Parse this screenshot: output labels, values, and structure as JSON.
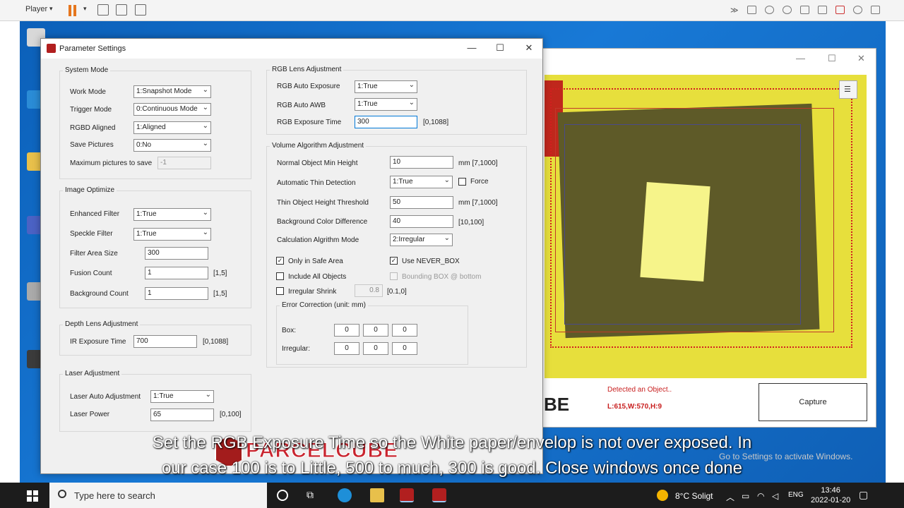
{
  "player": {
    "label": "Player"
  },
  "camera": {
    "detected": "Detected an Object..",
    "dims": "L:615,W:570,H:9",
    "capture": "Capture",
    "logo_fragment": "BE"
  },
  "dialog": {
    "title": "Parameter Settings",
    "system_mode": {
      "title": "System Mode",
      "work_mode": {
        "label": "Work Mode",
        "value": "1:Snapshot Mode"
      },
      "trigger_mode": {
        "label": "Trigger Mode",
        "value": "0:Continuous Mode"
      },
      "rgbd_aligned": {
        "label": "RGBD Aligned",
        "value": "1:Aligned"
      },
      "save_pictures": {
        "label": "Save Pictures",
        "value": "0:No"
      },
      "max_pictures": {
        "label": "Maximum pictures to save",
        "value": "-1"
      }
    },
    "image_optimize": {
      "title": "Image Optimize",
      "enhanced_filter": {
        "label": "Enhanced Filter",
        "value": "1:True"
      },
      "speckle_filter": {
        "label": "Speckle Filter",
        "value": "1:True"
      },
      "filter_area_size": {
        "label": "Filter Area Size",
        "value": "300"
      },
      "fusion_count": {
        "label": "Fusion Count",
        "value": "1",
        "range": "[1,5]"
      },
      "background_count": {
        "label": "Background Count",
        "value": "1",
        "range": "[1,5]"
      }
    },
    "depth_lens": {
      "title": "Depth Lens Adjustment",
      "ir_exposure": {
        "label": "IR Exposure Time",
        "value": "700",
        "range": "[0,1088]"
      }
    },
    "laser": {
      "title": "Laser Adjustment",
      "auto": {
        "label": "Laser Auto Adjustment",
        "value": "1:True"
      },
      "power": {
        "label": "Laser Power",
        "value": "65",
        "range": "[0,100]"
      }
    },
    "rgb_lens": {
      "title": "RGB Lens Adjustment",
      "auto_exposure": {
        "label": "RGB Auto Exposure",
        "value": "1:True"
      },
      "auto_awb": {
        "label": "RGB Auto AWB",
        "value": "1:True"
      },
      "exposure_time": {
        "label": "RGB Exposure Time",
        "value": "300",
        "range": "[0,1088]"
      }
    },
    "volume": {
      "title": "Volume Algorithm Adjustment",
      "min_height": {
        "label": "Normal Object Min Height",
        "value": "10",
        "range": "mm [7,1000]"
      },
      "auto_thin": {
        "label": "Automatic Thin Detection",
        "value": "1:True",
        "force_label": "Force",
        "force_checked": false
      },
      "thin_threshold": {
        "label": "Thin Object Height Threshold",
        "value": "50",
        "range": "mm [7,1000]"
      },
      "bg_color_diff": {
        "label": "Background Color Difference",
        "value": "40",
        "range": "[10,100]"
      },
      "calc_mode": {
        "label": "Calculation Algrithm Mode",
        "value": "2:Irregular"
      },
      "only_safe_area": {
        "label": "Only in Safe Area",
        "checked": true
      },
      "use_never_box": {
        "label": "Use NEVER_BOX",
        "checked": true
      },
      "include_all": {
        "label": "Include All Objects",
        "checked": false
      },
      "bounding_box_bottom": {
        "label": "Bounding BOX @ bottom",
        "checked": false
      },
      "irregular_shrink": {
        "label": "Irregular Shrink",
        "checked": false,
        "value": "0.8",
        "range": "[0.1,0]"
      },
      "error_correction": {
        "title": "Error Correction (unit: mm)",
        "box": {
          "label": "Box:",
          "values": [
            "0",
            "0",
            "0"
          ]
        },
        "irregular": {
          "label": "Irregular:",
          "values": [
            "0",
            "0",
            "0"
          ]
        }
      }
    }
  },
  "subtitle": {
    "line1": "Set the RGB Exposure Time so the White paper/envelop is not over exposed. In",
    "line2": "our case 100 is to Little, 500 to much, 300 is good. Close windows once done"
  },
  "watermark": {
    "text": "PARCELCUBE"
  },
  "activate": {
    "text": "Go to Settings to activate Windows."
  },
  "taskbar": {
    "search_placeholder": "Type here to search",
    "weather": "8°C Soligt",
    "lang": "ENG",
    "time": "13:46",
    "date": "2022-01-20"
  },
  "colors": {
    "accent": "#0078d7",
    "detected": "#c81e1e",
    "brand": "#b11f1f"
  }
}
